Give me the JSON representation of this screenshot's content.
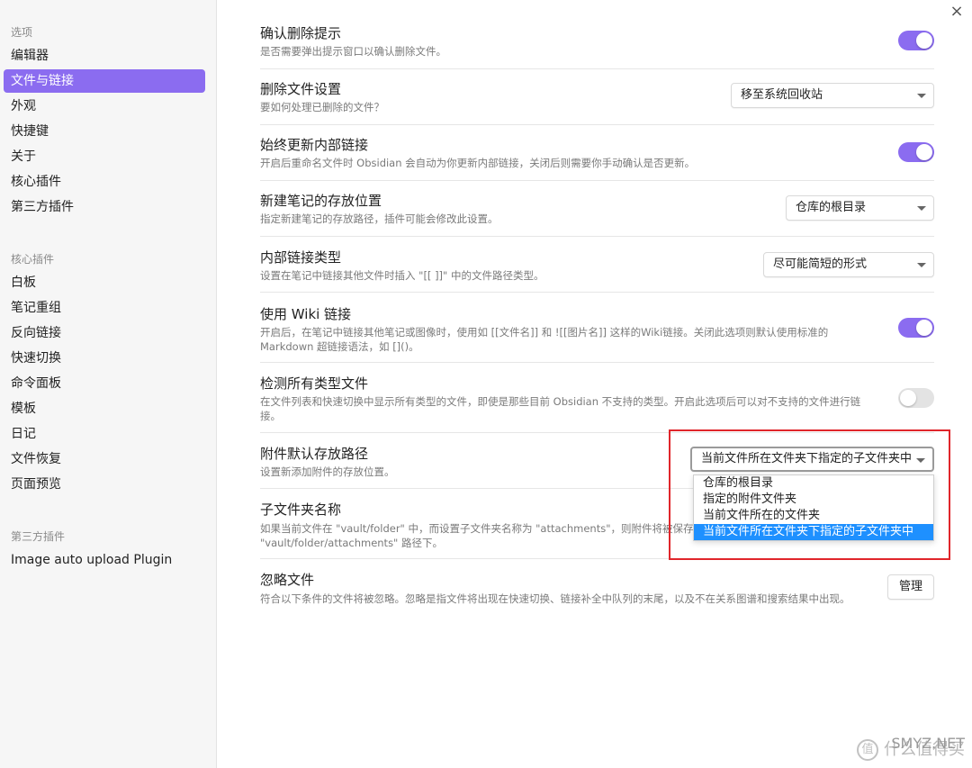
{
  "sidebar": {
    "group_options": "选项",
    "options": [
      "编辑器",
      "文件与链接",
      "外观",
      "快捷键",
      "关于",
      "核心插件",
      "第三方插件"
    ],
    "group_core": "核心插件",
    "core": [
      "白板",
      "笔记重组",
      "反向链接",
      "快速切换",
      "命令面板",
      "模板",
      "日记",
      "文件恢复",
      "页面预览"
    ],
    "group_third": "第三方插件",
    "third": [
      "Image auto upload Plugin"
    ]
  },
  "settings": {
    "confirm_delete": {
      "title": "确认删除提示",
      "desc": "是否需要弹出提示窗口以确认删除文件。",
      "enabled": true
    },
    "delete_files": {
      "title": "删除文件设置",
      "desc": "要如何处理已删除的文件？",
      "value": "移至系统回收站"
    },
    "auto_update_links": {
      "title": "始终更新内部链接",
      "desc": "开启后重命名文件时 Obsidian 会自动为你更新内部链接，关闭后则需要你手动确认是否更新。",
      "enabled": true
    },
    "new_note_location": {
      "title": "新建笔记的存放位置",
      "desc": "指定新建笔记的存放路径，插件可能会修改此设置。",
      "value": "仓库的根目录"
    },
    "link_format": {
      "title": "内部链接类型",
      "desc": "设置在笔记中链接其他文件时插入 \"[[ ]]\" 中的文件路径类型。",
      "value": "尽可能简短的形式"
    },
    "wiki_links": {
      "title": "使用 Wiki 链接",
      "desc_line1": "开启后，在笔记中链接其他笔记或图像时，使用如 [[文件名]] 和 ![[图片名]] 这样的Wiki链接。关闭此选项则默认使用标准的",
      "desc_line2": "Markdown 超链接语法，如 []()。",
      "enabled": true
    },
    "detect_all_types": {
      "title": "检测所有类型文件",
      "desc_line1": "在文件列表和快速切换中显示所有类型的文件，即使是那些目前 Obsidian 不支持的类型。开启此选项后可以对不支持的文件进行链",
      "desc_line2": "接。",
      "enabled": false
    },
    "attachment_location": {
      "title": "附件默认存放路径",
      "desc": "设置新添加附件的存放位置。",
      "value": "当前文件所在文件夹下指定的子文件夹中",
      "options": [
        "仓库的根目录",
        "指定的附件文件夹",
        "当前文件所在的文件夹",
        "当前文件所在文件夹下指定的子文件夹中"
      ],
      "selected_index": 3
    },
    "subfolder_name": {
      "title": "子文件夹名称",
      "desc_line1": "如果当前文件在 \"vault/folder\" 中，而设置子文件夹名称为 \"attachments\"，则附件将被保存",
      "desc_line2": "\"vault/folder/attachments\" 路径下。"
    },
    "ignore_files": {
      "title": "忽略文件",
      "desc": "符合以下条件的文件将被忽略。忽略是指文件将出现在快速切换、链接补全中队列的末尾，以及不在关系图谱和搜索结果中出现。",
      "button": "管理"
    }
  },
  "close_icon": "×",
  "watermark": {
    "logo": "值",
    "text": "什么值得买",
    "overlay": "SMYZ.NET"
  },
  "colors": {
    "accent": "#8b6cf0",
    "highlight": "#e0262b",
    "dropdown_selected": "#1e90ff"
  }
}
